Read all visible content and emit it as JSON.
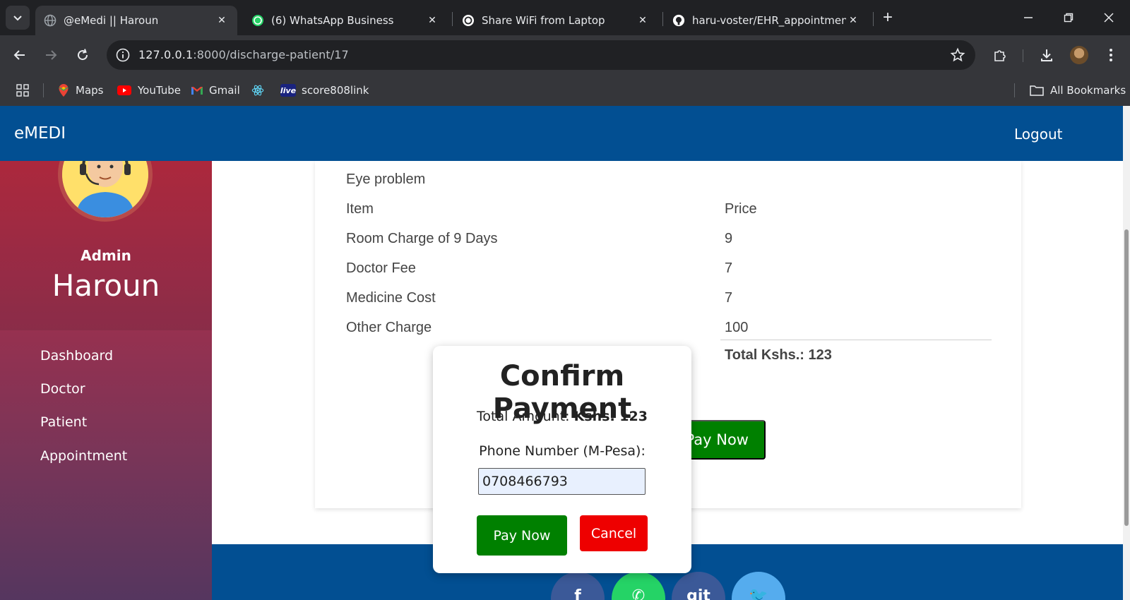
{
  "browser": {
    "tabs": [
      {
        "title": "@eMedi || Haroun",
        "icon": "globe-icon",
        "active": true
      },
      {
        "title": "(6) WhatsApp Business",
        "icon": "whatsapp-icon",
        "active": false
      },
      {
        "title": "Share WiFi from Laptop",
        "icon": "chatgpt-icon",
        "active": false
      },
      {
        "title": "haru-voster/EHR_appointment-",
        "icon": "github-icon",
        "active": false
      }
    ],
    "url_host": "127.0.0.1",
    "url_path": ":8000/discharge-patient/17",
    "bookmarks": [
      {
        "label": "Maps",
        "icon": "maps-icon"
      },
      {
        "label": "YouTube",
        "icon": "youtube-icon"
      },
      {
        "label": "Gmail",
        "icon": "gmail-icon"
      },
      {
        "label": "",
        "icon": "react-icon"
      },
      {
        "label": "score808link",
        "icon": "live-icon",
        "badge": "live"
      }
    ],
    "all_bookmarks": "All Bookmarks"
  },
  "nav": {
    "brand": "eMEDI",
    "logout": "Logout"
  },
  "sidebar": {
    "role": "Admin",
    "name": "Haroun",
    "links": [
      "Dashboard",
      "Doctor",
      "Patient",
      "Appointment"
    ]
  },
  "bill": {
    "symptom": "Eye problem",
    "header_item": "Item",
    "header_price": "Price",
    "rows": [
      {
        "item": "Room Charge of 9 Days",
        "price": "9"
      },
      {
        "item": "Doctor Fee",
        "price": "7"
      },
      {
        "item": "Medicine Cost",
        "price": "7"
      },
      {
        "item": "Other Charge",
        "price": "100"
      }
    ],
    "total": "Total Kshs.: 123"
  },
  "page_pay_button": "Pay Now",
  "modal": {
    "title": "Confirm Payment",
    "amount_label": "Total Amount:",
    "amount_value": "Kshs. 123",
    "phone_label": "Phone Number (M-Pesa):",
    "phone_value": "0708466793",
    "pay_button": "Pay Now",
    "cancel_button": "Cancel"
  },
  "footer": {
    "social": [
      {
        "icon": "facebook-icon",
        "glyph": "f",
        "color": "#3b5998"
      },
      {
        "icon": "whatsapp-icon",
        "glyph": "✆",
        "color": "#25d366"
      },
      {
        "icon": "git-icon",
        "glyph": "git",
        "color": "#3b5998"
      },
      {
        "icon": "twitter-icon",
        "glyph": "🐦",
        "color": "#55acee"
      }
    ]
  },
  "colors": {
    "navbar": "#024f92",
    "pay": "#008000",
    "cancel": "#ee0000"
  }
}
